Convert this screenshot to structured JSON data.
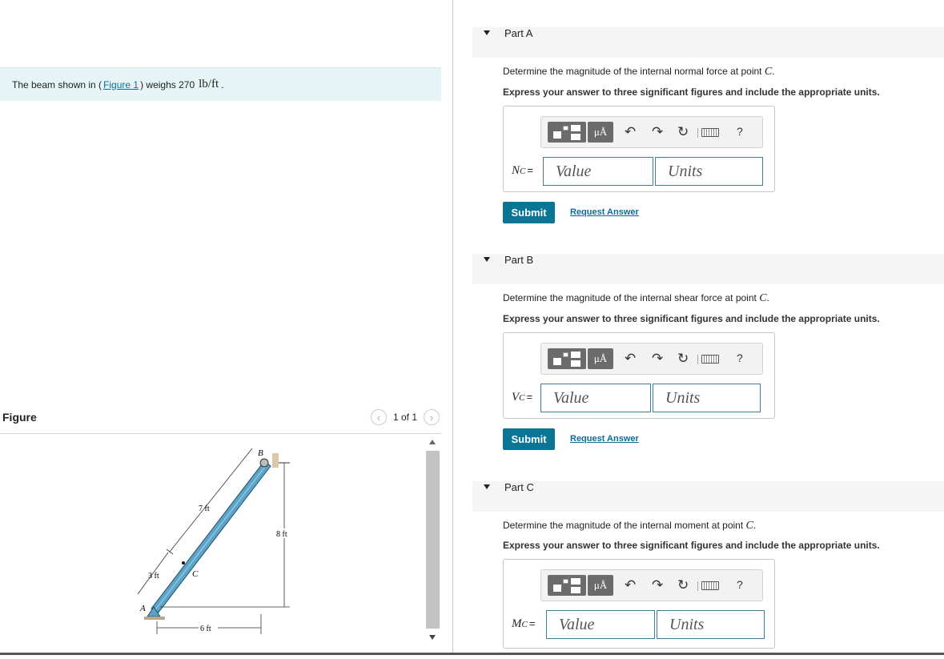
{
  "problem": {
    "prefix": "The beam shown in (",
    "figure_link": "Figure 1",
    "mid": ") weighs 270",
    "unit": "lb/ft",
    "suffix": "."
  },
  "figure": {
    "title": "Figure",
    "pager": "1 of 1",
    "labels": {
      "b": "B",
      "a": "A",
      "c": "C",
      "d7": "7 ft",
      "d3": "3 ft",
      "d8": "8 ft",
      "d6": "6 ft"
    }
  },
  "toolbar": {
    "units_glyph": "μÅ",
    "help": "?"
  },
  "parts": [
    {
      "title": "Part A",
      "question": "Determine the magnitude of the internal normal force at point",
      "point": "C",
      "instruction": "Express your answer to three significant figures and include the appropriate units.",
      "var": "N",
      "sub": "C",
      "eq": "=",
      "value_placeholder": "Value",
      "units_placeholder": "Units",
      "submit": "Submit",
      "request": "Request Answer"
    },
    {
      "title": "Part B",
      "question": "Determine the magnitude of the internal shear force at point",
      "point": "C",
      "instruction": "Express your answer to three significant figures and include the appropriate units.",
      "var": "V",
      "sub": "C",
      "eq": "=",
      "value_placeholder": "Value",
      "units_placeholder": "Units",
      "submit": "Submit",
      "request": "Request Answer"
    },
    {
      "title": "Part C",
      "question": "Determine the magnitude of the internal moment at point",
      "point": "C",
      "instruction": "Express your answer to three significant figures and include the appropriate units.",
      "var": "M",
      "sub": "C",
      "eq": "=",
      "value_placeholder": "Value",
      "units_placeholder": "Units"
    }
  ]
}
